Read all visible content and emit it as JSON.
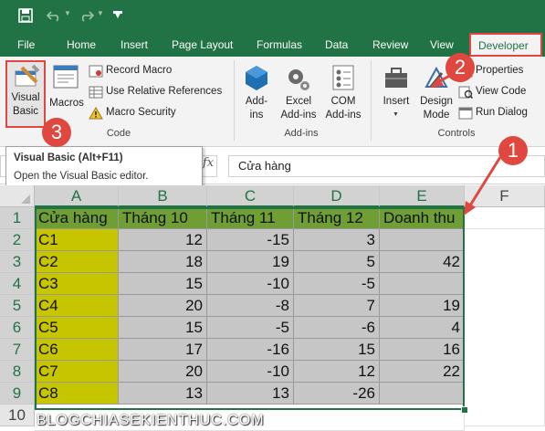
{
  "titlebar": {
    "save_icon": "save-icon",
    "undo_icon": "undo-icon",
    "redo_icon": "redo-icon",
    "qat_icon": "customize-quick-access-icon"
  },
  "tabs": [
    "File",
    "Home",
    "Insert",
    "Page Layout",
    "Formulas",
    "Data",
    "Review",
    "View",
    "Developer"
  ],
  "ribbon": {
    "code": {
      "visual_basic": [
        "Visual",
        "Basic"
      ],
      "macros": "Macros",
      "record_macro": "Record Macro",
      "use_relative": "Use Relative References",
      "macro_security": "Macro Security",
      "group": "Code"
    },
    "addins": {
      "addins": [
        "Add-",
        "ins"
      ],
      "excel_addins": [
        "Excel",
        "Add-ins"
      ],
      "com_addins": [
        "COM",
        "Add-ins"
      ],
      "group": "Add-ins"
    },
    "controls": {
      "insert": "Insert",
      "design_mode": [
        "Design",
        "Mode"
      ],
      "properties": "Properties",
      "view_code": "View Code",
      "run_dialog": "Run Dialog",
      "group": "Controls"
    }
  },
  "tooltip": {
    "title": "Visual Basic (Alt+F11)",
    "desc": "Open the Visual Basic editor."
  },
  "formula_bar": {
    "fx": "fx",
    "value": "Cửa hàng"
  },
  "callouts": [
    "1",
    "2",
    "3"
  ],
  "columns": [
    "A",
    "B",
    "C",
    "D",
    "E",
    "F"
  ],
  "rows": [
    "1",
    "2",
    "3",
    "4",
    "5",
    "6",
    "7",
    "8",
    "9",
    "10"
  ],
  "table": {
    "header": [
      "Cửa hàng",
      "Tháng 10",
      "Tháng 11",
      "Tháng 12",
      "Doanh thu"
    ],
    "rows": [
      [
        "C1",
        "12",
        "-15",
        "3",
        ""
      ],
      [
        "C2",
        "18",
        "19",
        "5",
        "42"
      ],
      [
        "C3",
        "15",
        "-10",
        "-5",
        ""
      ],
      [
        "C4",
        "20",
        "-8",
        "7",
        "19"
      ],
      [
        "C5",
        "15",
        "-5",
        "-6",
        "4"
      ],
      [
        "C6",
        "17",
        "-16",
        "15",
        "16"
      ],
      [
        "C7",
        "20",
        "-10",
        "12",
        "22"
      ],
      [
        "C8",
        "13",
        "13",
        "-26",
        ""
      ]
    ]
  },
  "watermark": "BLOGCHIASEKIENTHUC.COM",
  "colors": {
    "excel_green": "#217346",
    "callout_red": "#e0473f",
    "header_fill": "#6e9e34",
    "store_fill": "#c7c400",
    "value_fill": "#c6c6c6"
  }
}
